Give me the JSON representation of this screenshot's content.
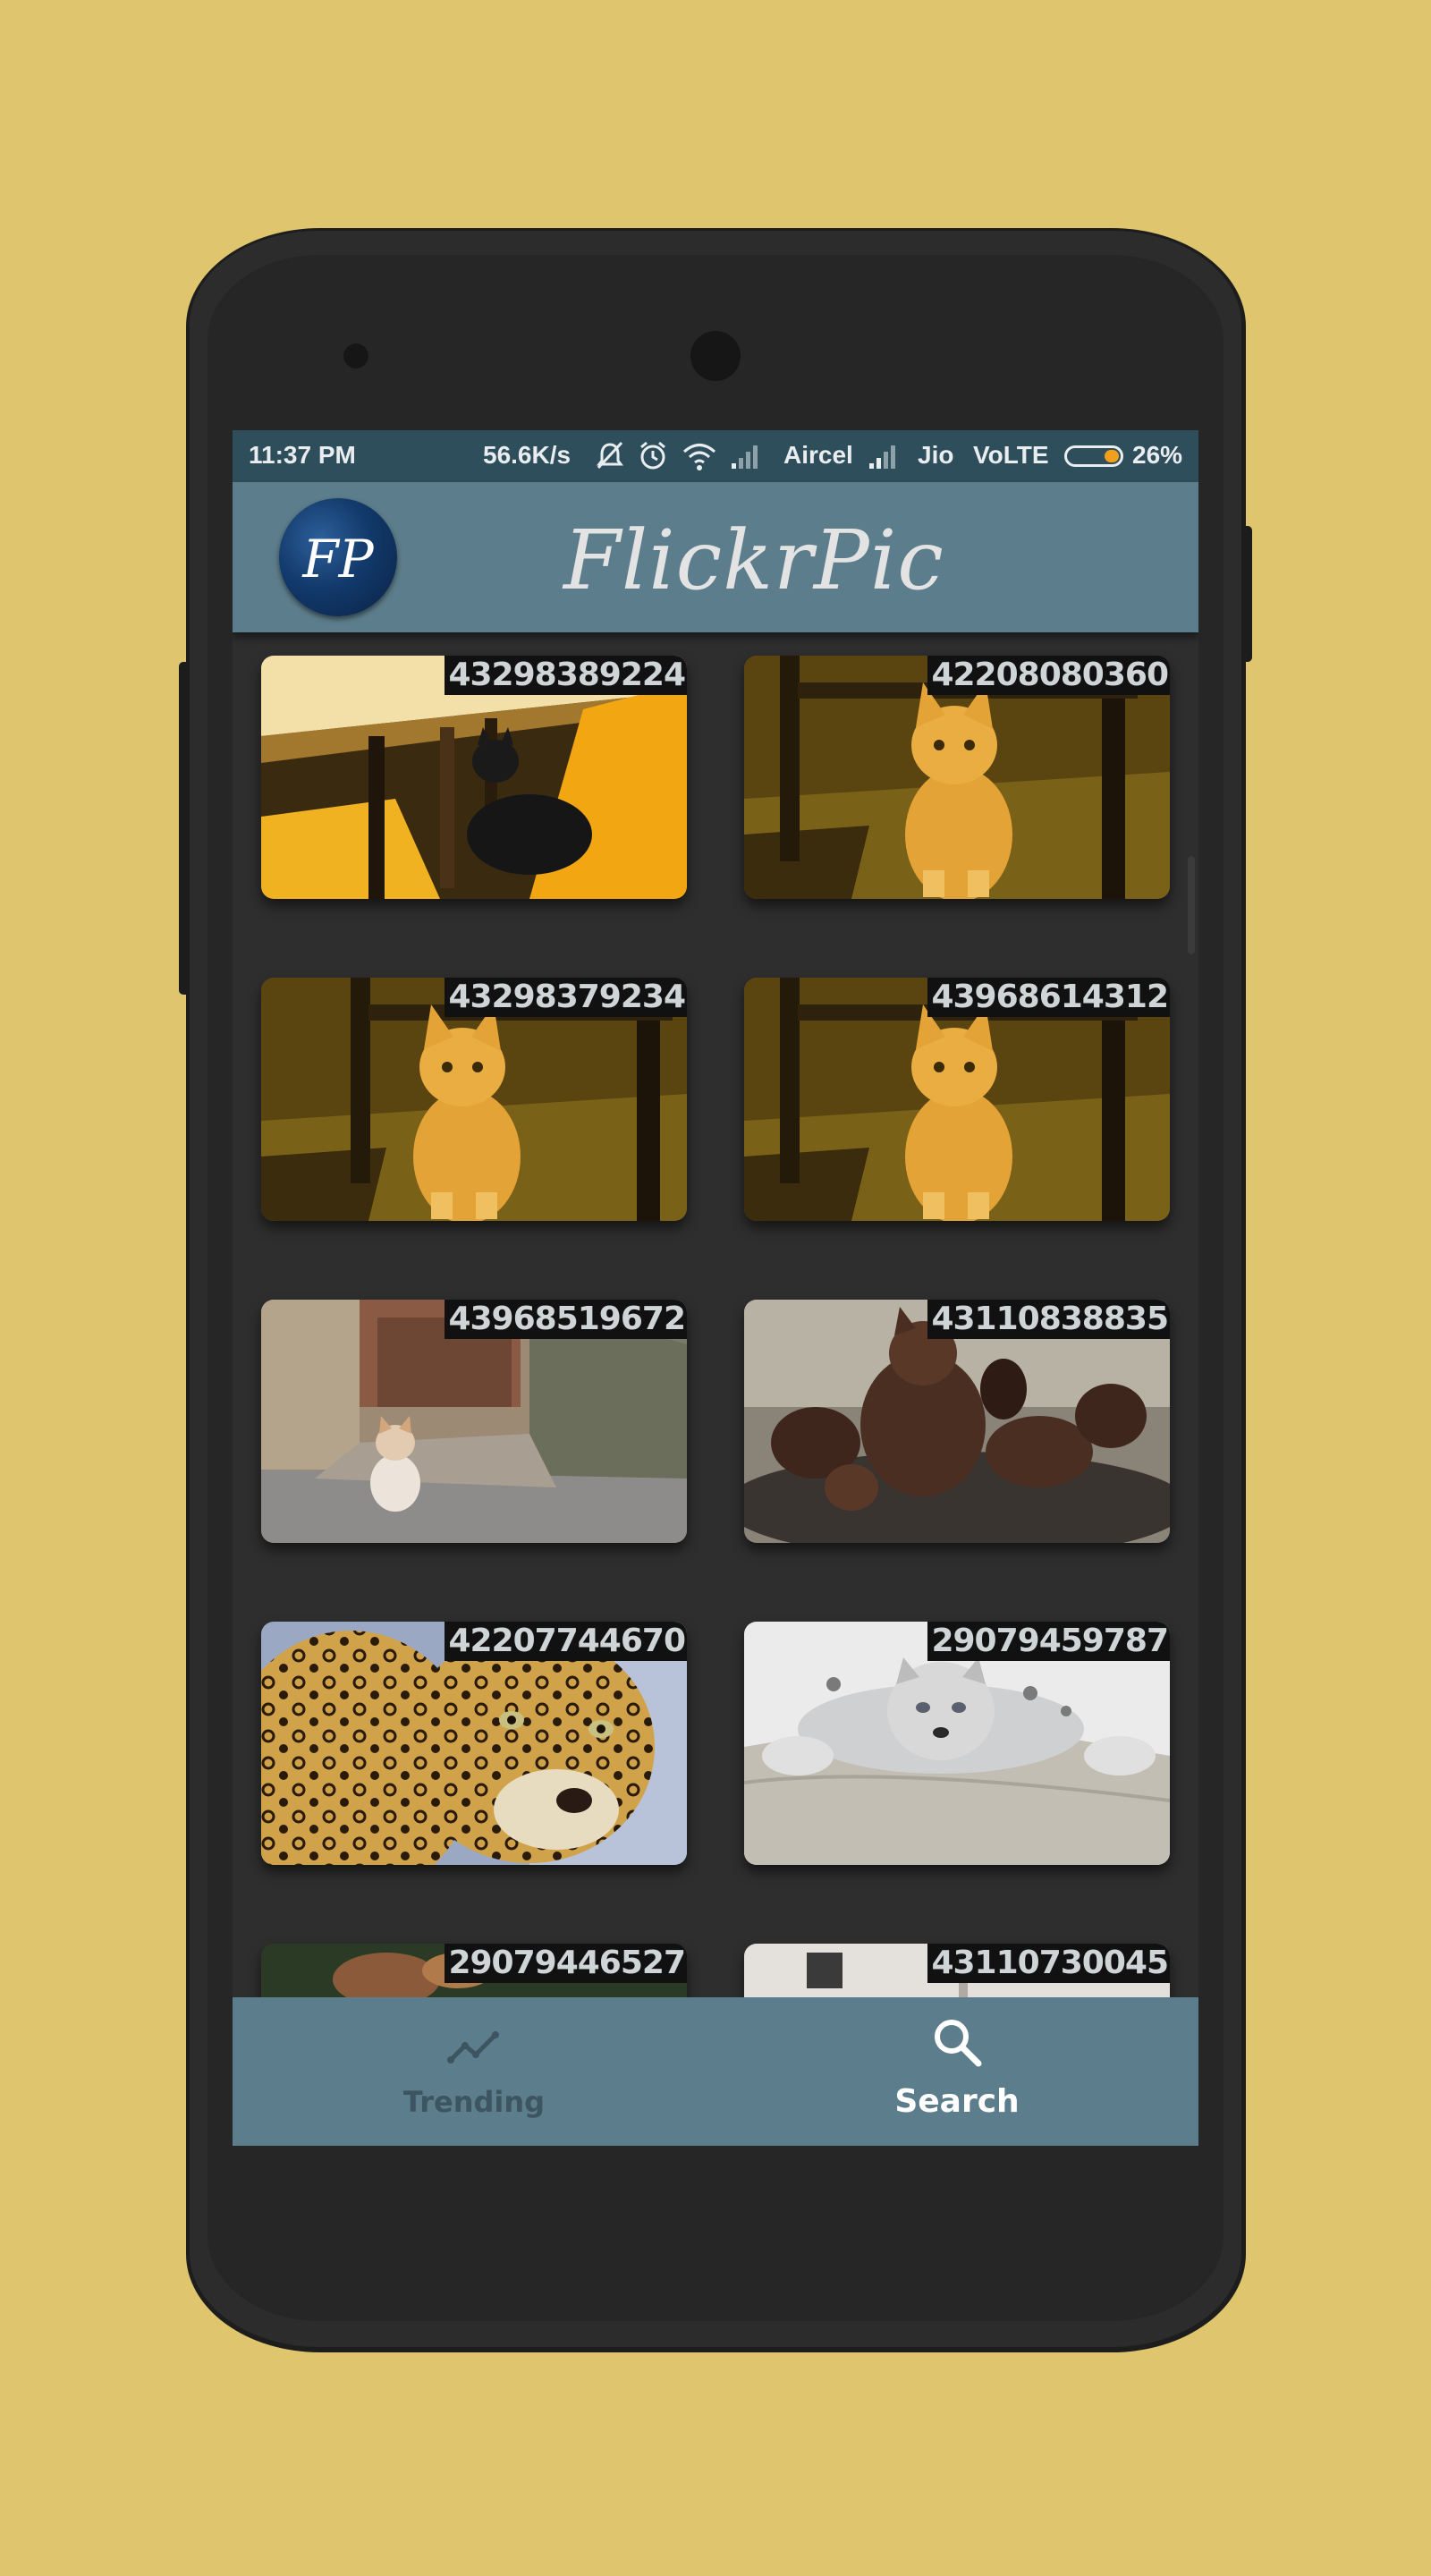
{
  "status_bar": {
    "time": "11:37 PM",
    "speed": "56.6K/s",
    "carrier1": "Aircel",
    "carrier2": "Jio",
    "network": "VoLTE",
    "battery": "26%",
    "battery_level": 0.26,
    "icons": [
      "mute-icon",
      "alarm-icon",
      "wifi-icon",
      "signal-icon",
      "signal-icon",
      "battery-icon"
    ]
  },
  "app": {
    "logo_text": "FP",
    "title": "FlickrPic"
  },
  "photos": [
    {
      "id": "43298389224",
      "subject": "cat-under-chair"
    },
    {
      "id": "42208080360",
      "subject": "orange-kitten"
    },
    {
      "id": "43298379234",
      "subject": "orange-kitten"
    },
    {
      "id": "43968614312",
      "subject": "orange-kitten"
    },
    {
      "id": "43968519672",
      "subject": "cat-on-street"
    },
    {
      "id": "43110838835",
      "subject": "cat-sculptures"
    },
    {
      "id": "42207744670",
      "subject": "leopard"
    },
    {
      "id": "29079459787",
      "subject": "snow-leopard"
    },
    {
      "id": "29079446527",
      "subject": "partial"
    },
    {
      "id": "43110730045",
      "subject": "partial"
    }
  ],
  "bottom_nav": {
    "trending_label": "Trending",
    "search_label": "Search",
    "active": "Search"
  },
  "colors": {
    "background": "#dfc66e",
    "status_bar": "#2e4e5c",
    "app_bar": "#5c7d8b",
    "screen_bg": "#2e2e2e",
    "id_badge": "#111111"
  }
}
